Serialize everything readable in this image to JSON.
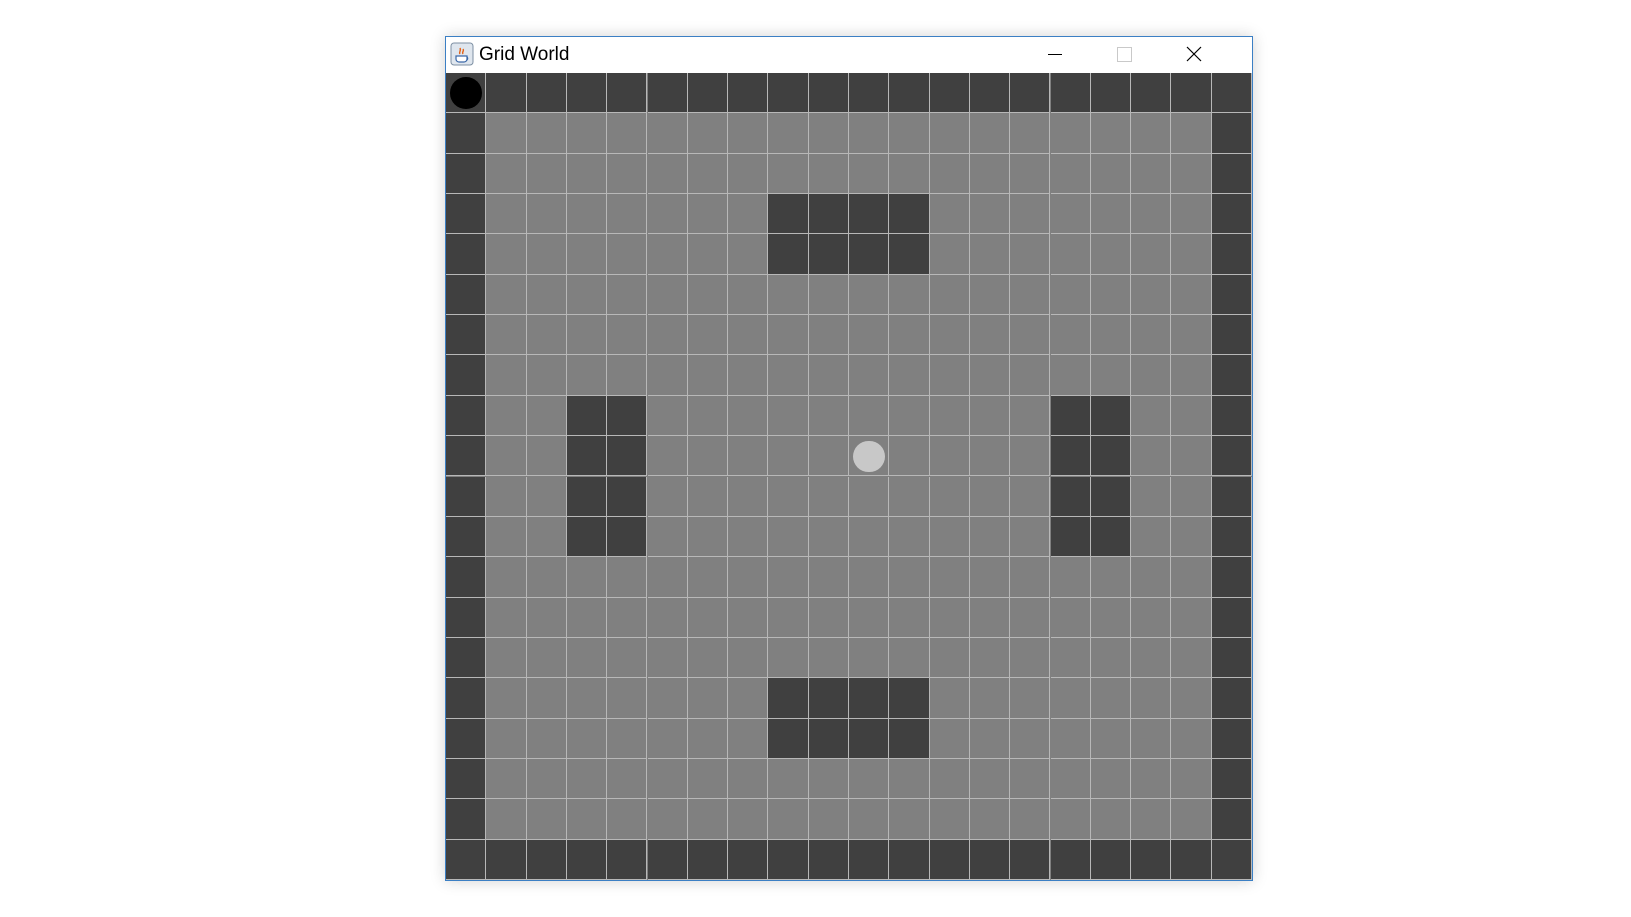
{
  "window": {
    "title": "Grid World",
    "icon": "java-cup-icon",
    "controls": [
      "minimize-icon",
      "maximize-icon",
      "close-icon"
    ]
  },
  "grid": {
    "rows": 20,
    "cols": 20,
    "colors": {
      "open": "#808080",
      "wall": "#404040",
      "grid_line": "#b8b8b8",
      "agent": "#000000",
      "goal": "#c8c8c8"
    },
    "walls": {
      "border": true,
      "inner_blocks": [
        {
          "row_start": 3,
          "row_end": 4,
          "col_start": 8,
          "col_end": 11
        },
        {
          "row_start": 8,
          "row_end": 11,
          "col_start": 3,
          "col_end": 4
        },
        {
          "row_start": 8,
          "row_end": 11,
          "col_start": 15,
          "col_end": 16
        },
        {
          "row_start": 15,
          "row_end": 16,
          "col_start": 8,
          "col_end": 11
        }
      ]
    },
    "agent": {
      "row": 0,
      "col": 0
    },
    "goal": {
      "row": 9,
      "col": 10
    }
  }
}
